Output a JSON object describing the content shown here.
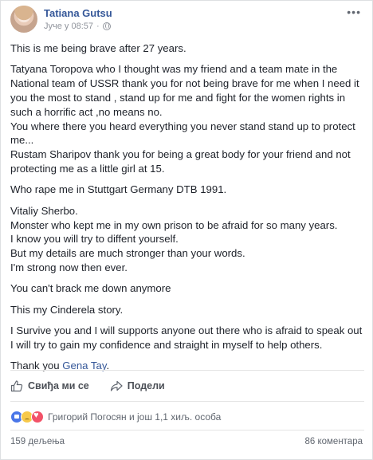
{
  "post": {
    "author": "Tatiana Gutsu",
    "timestamp": "Јуче у 08:57",
    "audience_icon": "globe-icon",
    "more_icon": "more-options-icon",
    "paragraphs": [
      "This is me being brave after 27 years.",
      "Tatyana Toropova who I thought was my friend and a team mate in the National team of USSR thank you for not being brave for me when I need it you the most to stand , stand up for me and fight for the women rights in such a horrific act ,no means no.\nYou where there you heard everything you never stand stand up to protect me...\nRustam Sharipov thank you for being a great body for your friend and not protecting me as a little girl at 15.",
      "Who rape me in Stuttgart Germany DTB 1991.",
      "Vitaliy Sherbo.\nMonster who kept me in my own prison to be afraid for so many years.\nI know you will try to diffent yourself.\nBut my details are much stronger than your words.\nI'm strong now then ever.",
      "You can't brack me down anymore",
      "This my Cinderela story.",
      "I Survive you and I will supports anyone out there who is afraid to speak out I will try to gain my confidence and straight in myself to help others."
    ],
    "thanks_prefix": "Thank you ",
    "thanks_link": "Gena Tay",
    "thanks_suffix": "."
  },
  "actions": {
    "like_label": "Свиђа ми се",
    "share_label": "Подели"
  },
  "reactions": {
    "icons": [
      "like-reaction-icon",
      "sad-reaction-icon",
      "love-reaction-icon"
    ],
    "names": "Григорий Погосян и још 1,1 хиљ. особа"
  },
  "stats": {
    "shares": "159 дељења",
    "comments": "86 коментара"
  },
  "colors": {
    "link": "#365899",
    "text": "#1d2129",
    "muted": "#90949c"
  }
}
